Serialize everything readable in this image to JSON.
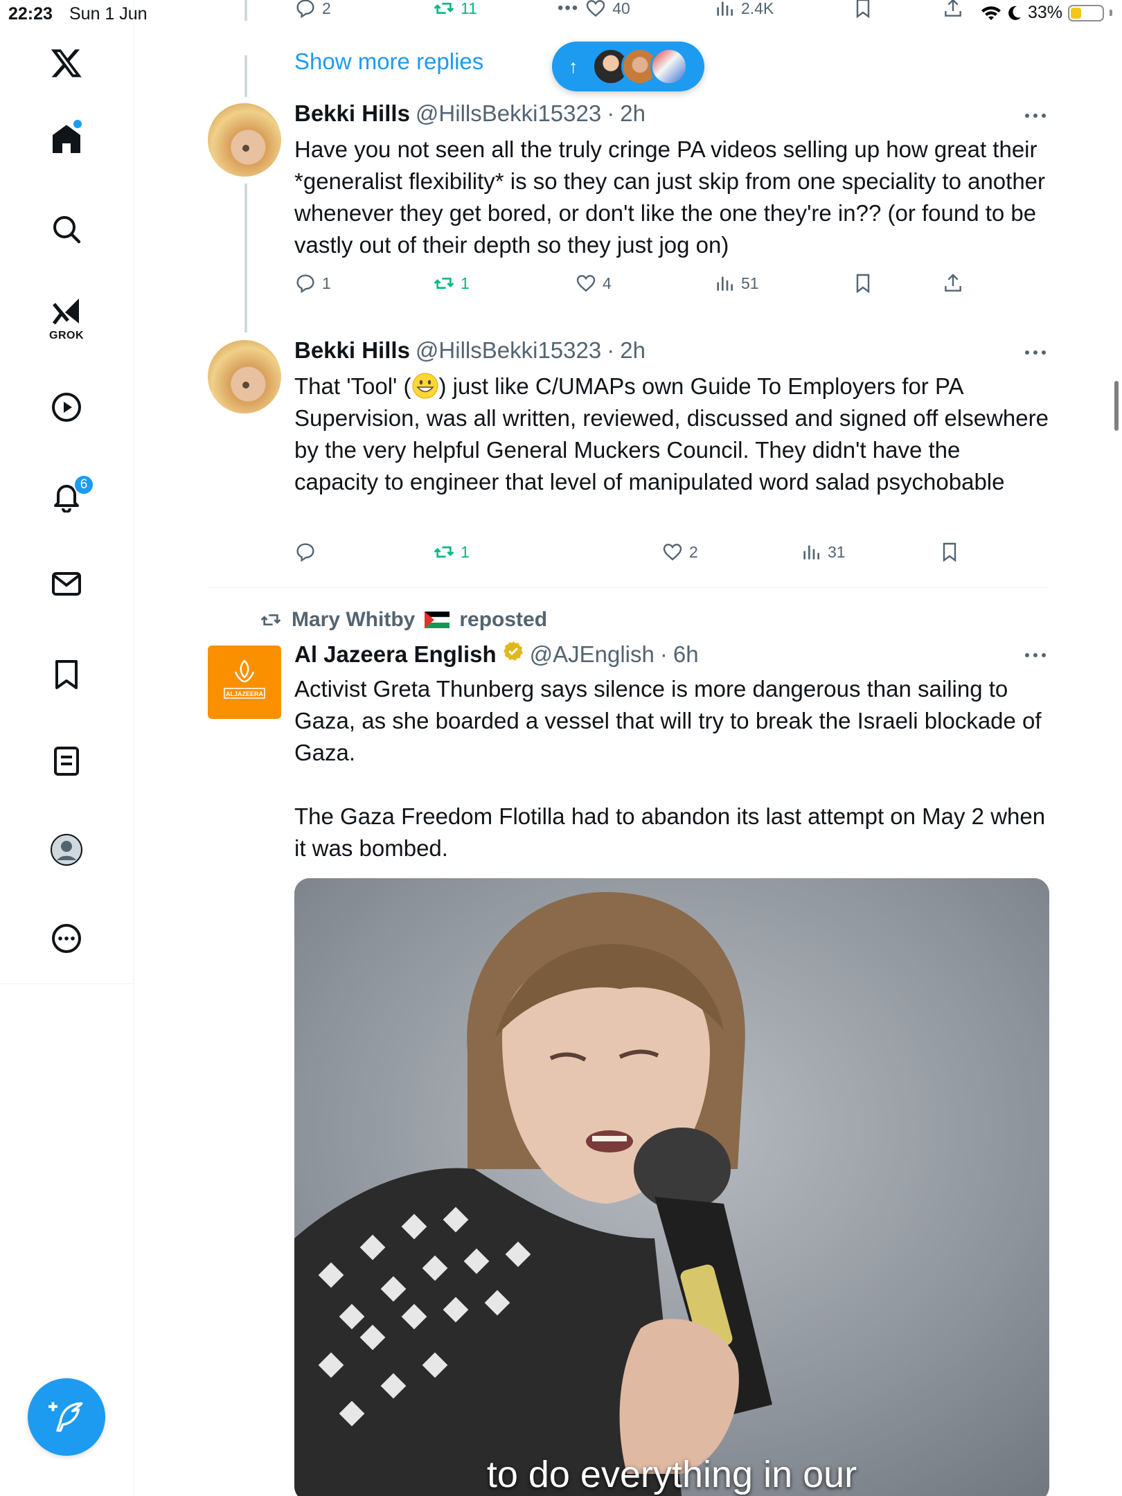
{
  "status_bar": {
    "time": "22:23",
    "date": "Sun 1 Jun",
    "battery": "33%",
    "battery_level": 0.33
  },
  "nav": {
    "items": [
      "x-logo",
      "home",
      "search",
      "grok",
      "video",
      "notifications",
      "messages",
      "bookmarks",
      "lists",
      "profile",
      "more"
    ],
    "grok_label": "GROK",
    "notifications_count": "6",
    "accent": "#1d9bf0"
  },
  "thread": {
    "top_actions": {
      "replies": "2",
      "reposts": "11",
      "likes": "40",
      "views": "2.4K"
    },
    "show_more": "Show more replies"
  },
  "posts": [
    {
      "name": "Bekki Hills",
      "handle": "@HillsBekki15323",
      "sep": "·",
      "time": "2h",
      "text": "Have you not seen all the truly cringe PA videos selling up how great their *generalist flexibility* is so they can just skip from one speciality to another whenever they get bored, or don't like the one they're in?? (or found to be vastly out of their depth so they just jog on)",
      "replies": "1",
      "reposts": "1",
      "likes": "4",
      "views": "51"
    },
    {
      "name": "Bekki Hills",
      "handle": "@HillsBekki15323",
      "sep": "·",
      "time": "2h",
      "text_a": "That 'Tool' (",
      "text_b": ") just like C/UMAPs own Guide To Employers for PA Supervision, was all written, reviewed, discussed and signed off elsewhere by the very helpful General Muckers Council. They didn't have the capacity to engineer that level of manipulated word salad psychobable",
      "replies": "",
      "reposts": "1",
      "likes": "2",
      "views": "31"
    },
    {
      "reposted_by": "Mary Whitby",
      "reposted_label": "reposted",
      "name": "Al Jazeera English",
      "handle": "@AJEnglish",
      "sep": "·",
      "time": "6h",
      "logo_text": "ALJAZEERA",
      "text": "Activist Greta Thunberg says silence is more dangerous than sailing to Gaza, as she boarded a vessel that will try to break the Israeli blockade of Gaza.\n\nThe Gaza Freedom Flotilla had to abandon its last attempt on May 2 when it was bombed.",
      "media_caption": "to do everything in our"
    }
  ]
}
